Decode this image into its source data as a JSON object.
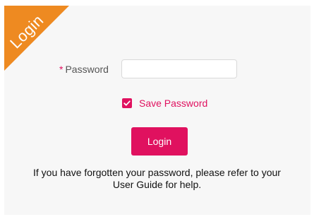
{
  "ribbon": {
    "label": "Login",
    "color": "#ee8a21"
  },
  "password": {
    "required_mark": "*",
    "label": "Password",
    "value": "",
    "placeholder": ""
  },
  "save_password": {
    "label": "Save Password",
    "checked": true
  },
  "login_button": {
    "label": "Login"
  },
  "help": {
    "line1": "If you have forgotten your password, please refer to your",
    "line2": "User Guide for help."
  },
  "colors": {
    "accent": "#e0115f",
    "panel_background": "#f7f7f7"
  },
  "icons": {
    "checkbox": "check-icon"
  }
}
